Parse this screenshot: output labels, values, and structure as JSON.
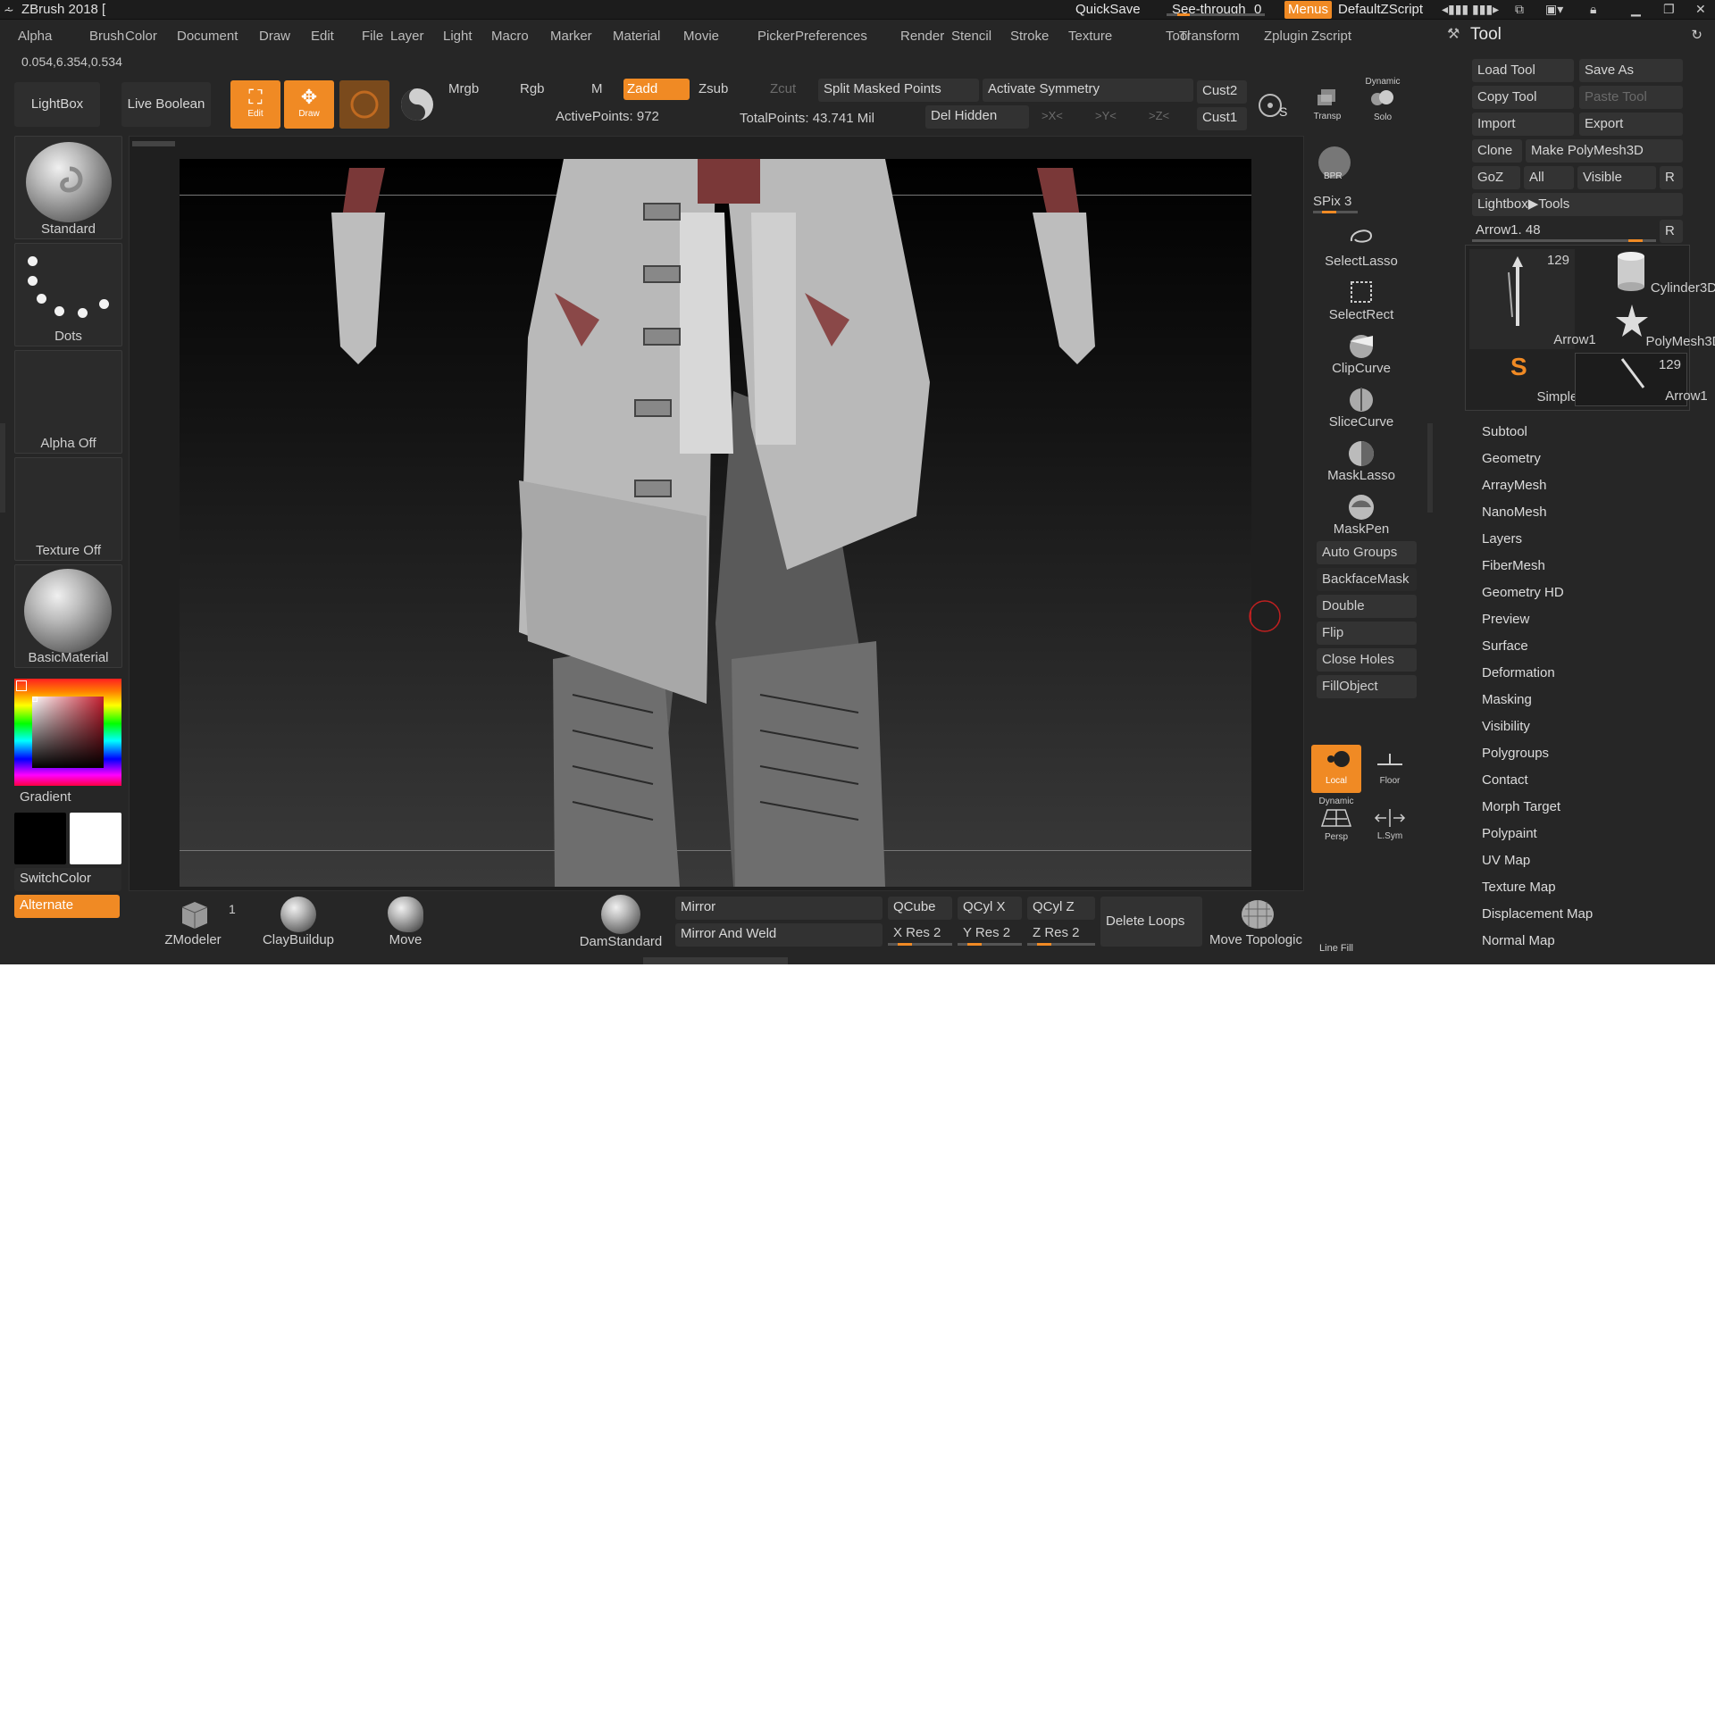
{
  "titlebar": {
    "app_title": "ZBrush 2018 [",
    "quicksave": "QuickSave",
    "see_through_label": "See-through",
    "see_through_value": "0",
    "see_through_level": 0.12,
    "menus_label": "Menus",
    "script_label": "DefaultZScript"
  },
  "menubar": [
    "Alpha",
    "Brush",
    "Color",
    "Document",
    "Draw",
    "Edit",
    "File",
    "Layer",
    "Light",
    "Macro",
    "Marker",
    "Material",
    "Movie",
    "Picker",
    "Preferences",
    "Render",
    "Stencil",
    "Stroke",
    "Texture",
    "Tool",
    "Transform",
    "Zplugin",
    "Zscript"
  ],
  "coords": "0.054,6.354,0.534",
  "topshelf": {
    "lightbox": "LightBox",
    "live_boolean": "Live Boolean",
    "edit": "Edit",
    "draw": "Draw",
    "mrgb": "Mrgb",
    "rgb": "Rgb",
    "m": "M",
    "zadd": "Zadd",
    "zsub": "Zsub",
    "zcut": "Zcut",
    "split_masked": "Split Masked Points",
    "activate_symmetry": "Activate Symmetry",
    "del_hidden": "Del Hidden",
    "sym_x": ">X<",
    "sym_y": ">Y<",
    "sym_z": ">Z<",
    "active_points": "ActivePoints: 972",
    "total_points": "TotalPoints: 43.741 Mil",
    "cust2": "Cust2",
    "cust1": "Cust1",
    "transp": "Transp",
    "dynamic": "Dynamic",
    "solo": "Solo"
  },
  "leftpanel": {
    "brush": "Standard",
    "stroke": "Dots",
    "alpha": "Alpha Off",
    "texture": "Texture Off",
    "material": "BasicMaterial",
    "gradient": "Gradient",
    "switchcolor": "SwitchColor",
    "alternate": "Alternate",
    "primary_color": "#000000",
    "secondary_color": "#ffffff"
  },
  "rightstrip": {
    "bpr": "BPR",
    "spix": "SPix 3",
    "spix_level": 0.3,
    "select_lasso": "SelectLasso",
    "select_rect": "SelectRect",
    "clip_curve": "ClipCurve",
    "slice_curve": "SliceCurve",
    "mask_lasso": "MaskLasso",
    "mask_pen": "MaskPen",
    "auto_groups": "Auto Groups",
    "backface_mask": "BackfaceMask",
    "double": "Double",
    "flip": "Flip",
    "close_holes": "Close Holes",
    "fill_object": "FillObject",
    "local": "Local",
    "floor": "Floor",
    "persp": "Persp",
    "persp_top": "Dynamic",
    "lsym": "L.Sym",
    "linefill": "Line Fill"
  },
  "toolpalette": {
    "title": "Tool",
    "load_tool": "Load Tool",
    "save_as": "Save As",
    "copy_tool": "Copy Tool",
    "paste_tool": "Paste Tool",
    "import": "Import",
    "export": "Export",
    "clone": "Clone",
    "make_polymesh": "Make PolyMesh3D",
    "goz": "GoZ",
    "all": "All",
    "visible": "Visible",
    "r": "R",
    "lightbox_tools": "Lightbox▶Tools",
    "current_tool": "Arrow1. 48",
    "current_level": 0.92,
    "tools": [
      {
        "name": "Arrow1",
        "count": "129"
      },
      {
        "name": "Cylinder3D",
        "count": ""
      },
      {
        "name": "PolyMesh3D",
        "count": ""
      },
      {
        "name": "SimpleBrush",
        "count": ""
      },
      {
        "name": "Arrow1",
        "count": "129"
      }
    ],
    "subpalettes": [
      "Subtool",
      "Geometry",
      "ArrayMesh",
      "NanoMesh",
      "Layers",
      "FiberMesh",
      "Geometry HD",
      "Preview",
      "Surface",
      "Deformation",
      "Masking",
      "Visibility",
      "Polygroups",
      "Contact",
      "Morph Target",
      "Polypaint",
      "UV Map",
      "Texture Map",
      "Displacement Map",
      "Normal Map"
    ]
  },
  "bottomshelf": {
    "zmodeler": "ZModeler",
    "zmodeler_count": "1",
    "claybuildup": "ClayBuildup",
    "move": "Move",
    "damstandard": "DamStandard",
    "mirror": "Mirror",
    "mirror_weld": "Mirror And Weld",
    "qcube": "QCube",
    "qcylx": "QCyl X",
    "qcylz": "QCyl Z",
    "xres": "X Res 2",
    "yres": "Y Res 2",
    "zres": "Z Res 2",
    "res_level": 0.2,
    "delete_loops": "Delete Loops",
    "move_topologic": "Move Topologic"
  }
}
